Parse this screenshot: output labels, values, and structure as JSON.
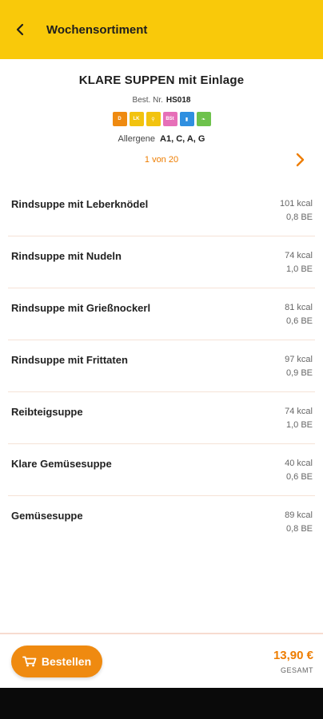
{
  "header": {
    "title": "Wochensortiment"
  },
  "product": {
    "name": "KLARE SUPPEN mit Einlage",
    "bestnr_label": "Best. Nr.",
    "bestnr_value": "HS018",
    "badges": [
      {
        "text": "D",
        "color": "#ef8a10"
      },
      {
        "text": "LK",
        "color": "#f2c30f"
      },
      {
        "text": "⚲",
        "color": "#f2c30f"
      },
      {
        "text": "BSt",
        "color": "#e66fb8"
      },
      {
        "text": "▮",
        "color": "#2f8fe0"
      },
      {
        "text": "❧",
        "color": "#6ec24c"
      }
    ],
    "allergene_label": "Allergene",
    "allergene_value": "A1, C, A, G",
    "pager": "1 von 20"
  },
  "items": [
    {
      "name": "Rindsuppe mit Leberknödel",
      "kcal": "101 kcal",
      "be": "0,8 BE"
    },
    {
      "name": "Rindsuppe mit Nudeln",
      "kcal": "74 kcal",
      "be": "1,0 BE"
    },
    {
      "name": "Rindsuppe mit Grießnockerl",
      "kcal": "81 kcal",
      "be": "0,6 BE"
    },
    {
      "name": "Rindsuppe mit Frittaten",
      "kcal": "97 kcal",
      "be": "0,9 BE"
    },
    {
      "name": "Reibteigsuppe",
      "kcal": "74 kcal",
      "be": "1,0 BE"
    },
    {
      "name": "Klare Gemüsesuppe",
      "kcal": "40 kcal",
      "be": "0,6 BE"
    },
    {
      "name": "Gemüsesuppe",
      "kcal": "89 kcal",
      "be": "0,8 BE"
    }
  ],
  "footer": {
    "order_label": "Bestellen",
    "price": "13,90 €",
    "total_label": "GESAMT"
  },
  "colors": {
    "header_bg": "#f9c90a",
    "accent": "#ee7d00"
  },
  "icons": {
    "back": "back-arrow-icon",
    "next": "chevron-right-icon",
    "cart": "cart-icon"
  }
}
